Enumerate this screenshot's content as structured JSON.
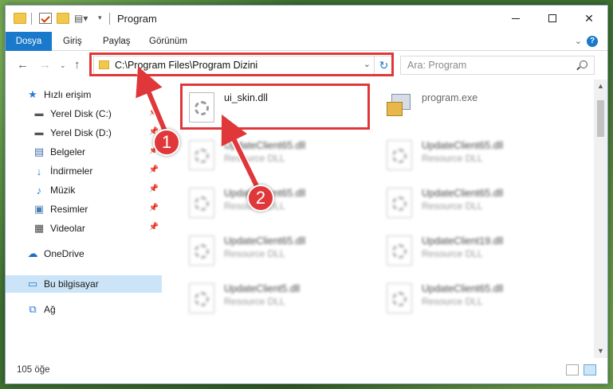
{
  "window": {
    "title": "Program",
    "min_glyph": "",
    "close_glyph": "✕"
  },
  "ribbon": {
    "tabs": [
      "Dosya",
      "Giriş",
      "Paylaş",
      "Görünüm"
    ],
    "help_label": "?"
  },
  "nav": {
    "address": "C:\\Program Files\\Program Dizini",
    "search_placeholder": "Ara: Program"
  },
  "sidebar": {
    "items": [
      {
        "label": "Hızlı erişim",
        "icon": "star-icon",
        "pinned": false
      },
      {
        "label": "Yerel Disk (C:)",
        "icon": "drive-icon",
        "pinned": true
      },
      {
        "label": "Yerel Disk (D:)",
        "icon": "drive-icon",
        "pinned": true
      },
      {
        "label": "Belgeler",
        "icon": "documents-icon",
        "pinned": true
      },
      {
        "label": "İndirmeler",
        "icon": "download-icon",
        "pinned": true
      },
      {
        "label": "Müzik",
        "icon": "music-icon",
        "pinned": true
      },
      {
        "label": "Resimler",
        "icon": "pictures-icon",
        "pinned": true
      },
      {
        "label": "Videolar",
        "icon": "video-icon",
        "pinned": true
      },
      {
        "label": "OneDrive",
        "icon": "cloud-icon",
        "pinned": false
      },
      {
        "label": "Bu bilgisayar",
        "icon": "computer-icon",
        "pinned": false,
        "selected": true
      },
      {
        "label": "Ağ",
        "icon": "network-icon",
        "pinned": false
      }
    ]
  },
  "files": [
    {
      "name": "ui_skin.dll",
      "type": "",
      "kind": "dll",
      "highlighted": true
    },
    {
      "name": "program.exe",
      "type": "",
      "kind": "exe"
    },
    {
      "name": "UpdateClient65.dll",
      "type": "Resource DLL",
      "kind": "dll",
      "blurred": true
    },
    {
      "name": "UpdateClient65.dll",
      "type": "Resource DLL",
      "kind": "dll",
      "blurred": true
    },
    {
      "name": "UpdateClient65.dll",
      "type": "Resource DLL",
      "kind": "dll",
      "blurred": true
    },
    {
      "name": "UpdateClient65.dll",
      "type": "Resource DLL",
      "kind": "dll",
      "blurred": true
    },
    {
      "name": "UpdateClient65.dll",
      "type": "Resource DLL",
      "kind": "dll",
      "blurred": true
    },
    {
      "name": "UpdateClient19.dll",
      "type": "Resource DLL",
      "kind": "dll",
      "blurred": true
    },
    {
      "name": "UpdateClient5.dll",
      "type": "Resource DLL",
      "kind": "dll",
      "blurred": true
    },
    {
      "name": "UpdateClient65.dll",
      "type": "Resource DLL",
      "kind": "dll",
      "blurred": true
    }
  ],
  "status": {
    "item_count": "105 öğe"
  },
  "annotations": {
    "callout_1": "1",
    "callout_2": "2",
    "color": "#e0383a"
  },
  "colors": {
    "accent": "#1979ca",
    "selection": "#cce4f7"
  }
}
